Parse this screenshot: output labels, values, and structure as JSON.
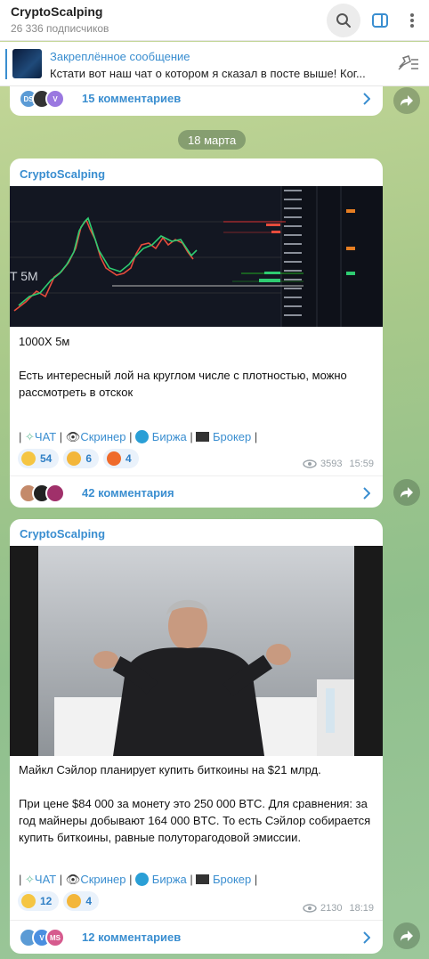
{
  "header": {
    "title": "CryptoScalping",
    "subscribers": "26 336 подписчиков"
  },
  "pinned": {
    "title": "Закреплённое сообщение",
    "text": "Кстати вот наш чат о котором я сказал в посте выше! Ког..."
  },
  "top_partial": {
    "avatars": [
      "DS",
      "",
      "V"
    ],
    "comments": "15 комментариев"
  },
  "date_separator": "18 марта",
  "messages": [
    {
      "author": "CryptoScalping",
      "chart_overlay": "T 5M",
      "text": "1000X  5м\n\nЕсть интересный лой на круглом числе с плотностью, можно рассмотреть в отскок",
      "links": [
        "ЧАТ",
        "Скринер",
        "Биржа",
        "Брокер"
      ],
      "reactions": [
        {
          "emoji": "thumbs-up",
          "count": "54"
        },
        {
          "emoji": "thinking",
          "count": "6"
        },
        {
          "emoji": "fire",
          "count": "4"
        }
      ],
      "views": "3593",
      "time": "15:59",
      "comments": "42 комментария"
    },
    {
      "author": "CryptoScalping",
      "text": "Майкл Сэйлор планирует купить биткоины на $21 млрд.\n\nПри цене $84 000 за монету это 250 000 BTC. Для сравнения: за год майнеры добывают 164 000 BTC. То есть Сэйлор собирается купить биткоины, равные полуторагодовой эмиссии.",
      "links": [
        "ЧАТ",
        "Скринер",
        "Биржа",
        "Брокер"
      ],
      "reactions": [
        {
          "emoji": "thumbs-up",
          "count": "12"
        },
        {
          "emoji": "thinking",
          "count": "4"
        }
      ],
      "views": "2130",
      "time": "18:19",
      "avatars": [
        "",
        "V",
        "MS"
      ],
      "comments": "12 комментариев"
    }
  ],
  "colors": {
    "accent": "#3a8ed0",
    "reaction_bg": "#eaf2fb"
  }
}
